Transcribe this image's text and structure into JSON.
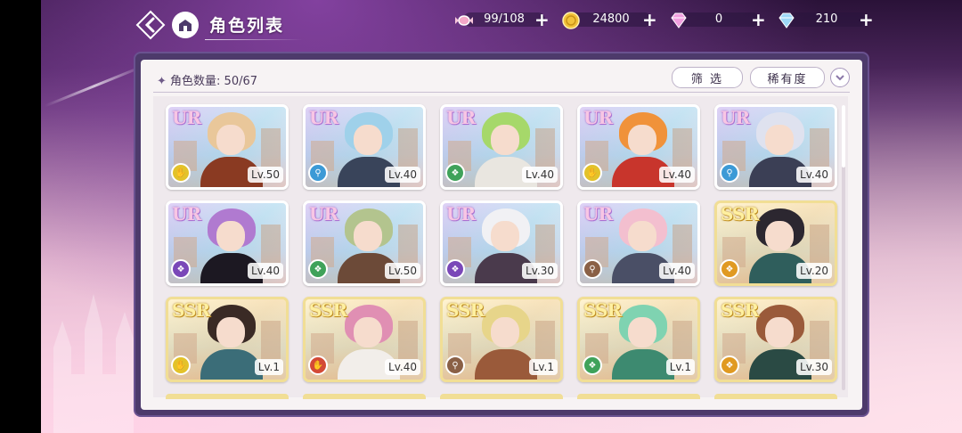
{
  "header": {
    "title": "角色列表"
  },
  "resources": [
    {
      "name": "candy",
      "icon": "candy-icon",
      "value": "99/108"
    },
    {
      "name": "gold",
      "icon": "gold-coin-icon",
      "value": "24800"
    },
    {
      "name": "pink-gem",
      "icon": "pink-diamond-icon",
      "value": "0"
    },
    {
      "name": "blue-gem",
      "icon": "blue-diamond-icon",
      "value": "210"
    }
  ],
  "panel": {
    "count_label": "角色数量: 50/67",
    "filter_label": "筛 选",
    "rarity_label": "稀有度"
  },
  "colors": {
    "panel_frame": "#4d3a6b",
    "ur_frame": "#ffffff",
    "ssr_frame": "#f1de95"
  },
  "cards": [
    {
      "rarity": "UR",
      "level": "Lv.50",
      "element": "yellow",
      "hair": "#e9c79a",
      "outfit": "#8a3a22"
    },
    {
      "rarity": "UR",
      "level": "Lv.40",
      "element": "blue",
      "hair": "#9fd1ea",
      "outfit": "#39445a"
    },
    {
      "rarity": "UR",
      "level": "Lv.40",
      "element": "green",
      "hair": "#a6d86a",
      "outfit": "#e9e6e0"
    },
    {
      "rarity": "UR",
      "level": "Lv.40",
      "element": "yellow",
      "hair": "#f0923a",
      "outfit": "#c8352c"
    },
    {
      "rarity": "UR",
      "level": "Lv.40",
      "element": "blue",
      "hair": "#dfe2ef",
      "outfit": "#3b3f55"
    },
    {
      "rarity": "UR",
      "level": "Lv.40",
      "element": "purple",
      "hair": "#b07ad0",
      "outfit": "#1c1822"
    },
    {
      "rarity": "UR",
      "level": "Lv.50",
      "element": "green",
      "hair": "#b3c48e",
      "outfit": "#6c4a38"
    },
    {
      "rarity": "UR",
      "level": "Lv.30",
      "element": "purple",
      "hair": "#f1f1f4",
      "outfit": "#4a3a4c"
    },
    {
      "rarity": "UR",
      "level": "Lv.40",
      "element": "brown",
      "hair": "#f3bfcf",
      "outfit": "#4a4f66"
    },
    {
      "rarity": "SSR",
      "level": "Lv.20",
      "element": "orange",
      "hair": "#2c2730",
      "outfit": "#2f5e5c"
    },
    {
      "rarity": "SSR",
      "level": "Lv.1",
      "element": "yellow",
      "hair": "#3a2a25",
      "outfit": "#3b6d78"
    },
    {
      "rarity": "SSR",
      "level": "Lv.40",
      "element": "red",
      "hair": "#e08fb3",
      "outfit": "#f2eeea"
    },
    {
      "rarity": "SSR",
      "level": "Lv.1",
      "element": "brown",
      "hair": "#e7d58a",
      "outfit": "#9a5a3a"
    },
    {
      "rarity": "SSR",
      "level": "Lv.1",
      "element": "green",
      "hair": "#7fd3b1",
      "outfit": "#3d8a70"
    },
    {
      "rarity": "SSR",
      "level": "Lv.30",
      "element": "orange",
      "hair": "#9a5a3a",
      "outfit": "#2a4a44"
    }
  ],
  "peek_cards": [
    "#f1de95",
    "#f1de95",
    "#f1de95",
    "#f1de95",
    "#f1de95"
  ]
}
